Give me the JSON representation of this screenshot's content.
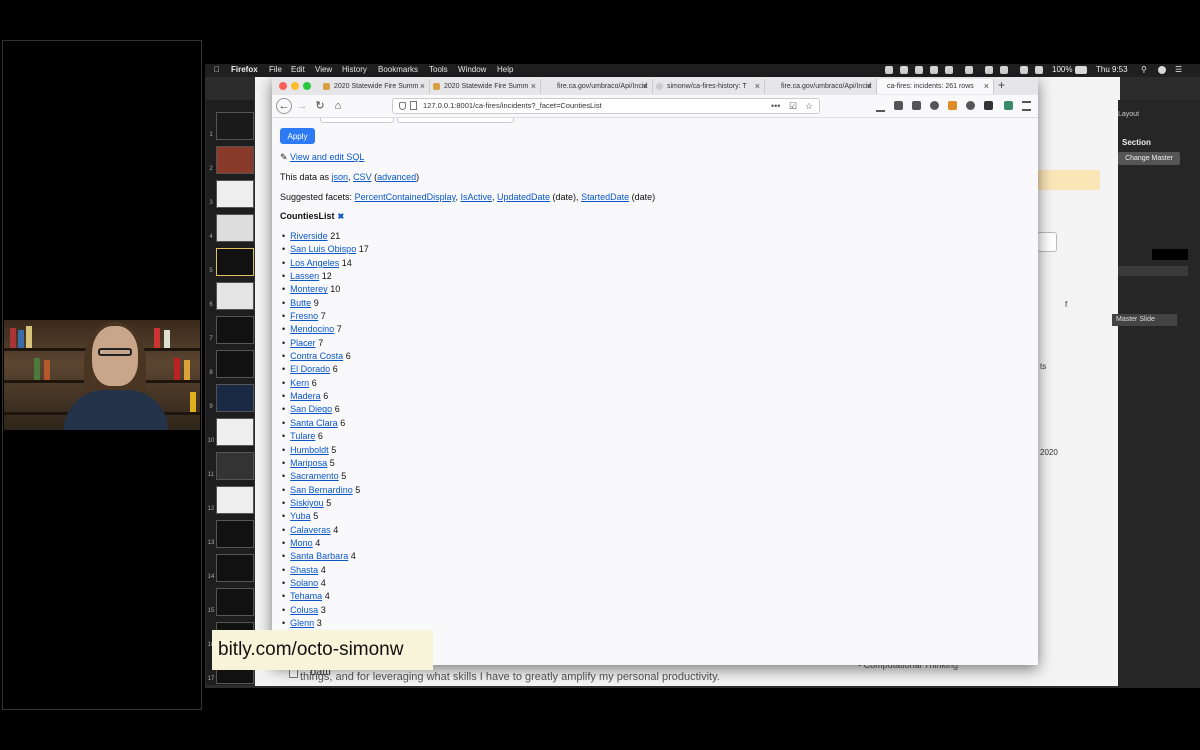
{
  "menubar": {
    "app": "Firefox",
    "items": [
      "File",
      "Edit",
      "View",
      "History",
      "Bookmarks",
      "Tools",
      "Window",
      "Help"
    ],
    "battery": "100%",
    "clock": "Thu 9:53"
  },
  "browser": {
    "tabs": [
      {
        "label": "2020 Statewide Fire Summ",
        "active": false
      },
      {
        "label": "2020 Statewide Fire Summ",
        "active": false
      },
      {
        "label": "fire.ca.gov/umbraco/Api/Incid",
        "active": false
      },
      {
        "label": "simonw/ca-fires-history: T",
        "active": false
      },
      {
        "label": "fire.ca.gov/umbraco/Api/Incid",
        "active": false
      },
      {
        "label": "ca-fires: incidents: 261 rows",
        "active": true
      }
    ],
    "url": "127.0.0.1:8001/ca-fires/incidents?_facet=CountiesList",
    "url_more": "•••"
  },
  "page": {
    "apply_label": "Apply",
    "view_sql_prefix": "✎ ",
    "view_sql_label": "View and edit SQL",
    "data_as_prefix": "This data as ",
    "json_label": "json",
    "sep_comma": ", ",
    "csv_label": "CSV",
    "advanced_open": " (",
    "advanced_label": "advanced",
    "advanced_close": ")",
    "suggested_prefix": "Suggested facets: ",
    "suggested": [
      {
        "name": "PercentContainedDisplay",
        "suffix": ", "
      },
      {
        "name": "IsActive",
        "suffix": ", "
      },
      {
        "name": "UpdatedDate",
        "suffix": " (date), "
      },
      {
        "name": "StartedDate",
        "suffix": " (date)"
      }
    ],
    "facet_title": "CountiesList",
    "facet_clear": "✖",
    "facet_values": [
      {
        "label": "Riverside",
        "count": "21"
      },
      {
        "label": "San Luis Obispo",
        "count": "17"
      },
      {
        "label": "Los Angeles",
        "count": "14"
      },
      {
        "label": "Lassen",
        "count": "12"
      },
      {
        "label": "Monterey",
        "count": "10"
      },
      {
        "label": "Butte",
        "count": "9"
      },
      {
        "label": "Fresno",
        "count": "7"
      },
      {
        "label": "Mendocino",
        "count": "7"
      },
      {
        "label": "Placer",
        "count": "7"
      },
      {
        "label": "Contra Costa",
        "count": "6"
      },
      {
        "label": "El Dorado",
        "count": "6"
      },
      {
        "label": "Kern",
        "count": "6"
      },
      {
        "label": "Madera",
        "count": "6"
      },
      {
        "label": "San Diego",
        "count": "6"
      },
      {
        "label": "Santa Clara",
        "count": "6"
      },
      {
        "label": "Tulare",
        "count": "6"
      },
      {
        "label": "Humboldt",
        "count": "5"
      },
      {
        "label": "Mariposa",
        "count": "5"
      },
      {
        "label": "Sacramento",
        "count": "5"
      },
      {
        "label": "San Bernardino",
        "count": "5"
      },
      {
        "label": "Siskiyou",
        "count": "5"
      },
      {
        "label": "Yuba",
        "count": "5"
      },
      {
        "label": "Calaveras",
        "count": "4"
      },
      {
        "label": "Mono",
        "count": "4"
      },
      {
        "label": "Santa Barbara",
        "count": "4"
      },
      {
        "label": "Shasta",
        "count": "4"
      },
      {
        "label": "Solano",
        "count": "4"
      },
      {
        "label": "Tehama",
        "count": "4"
      },
      {
        "label": "Colusa",
        "count": "3"
      },
      {
        "label": "Glenn",
        "count": "3"
      }
    ]
  },
  "keynote": {
    "layout_label": "Layout",
    "section_label": "Section",
    "change_master_label": "Change Master",
    "master_slide_label": "Master Slide",
    "frag_f": "f",
    "frag_ts": "ts",
    "frag_2020": "2020",
    "bottom_text": "things, and for leveraging what skills I have to greatly amplify my personal productivity.",
    "bottom_item": "• Computational Thinking",
    "partial_word": "battl"
  },
  "caption": "bitly.com/octo-simonw"
}
